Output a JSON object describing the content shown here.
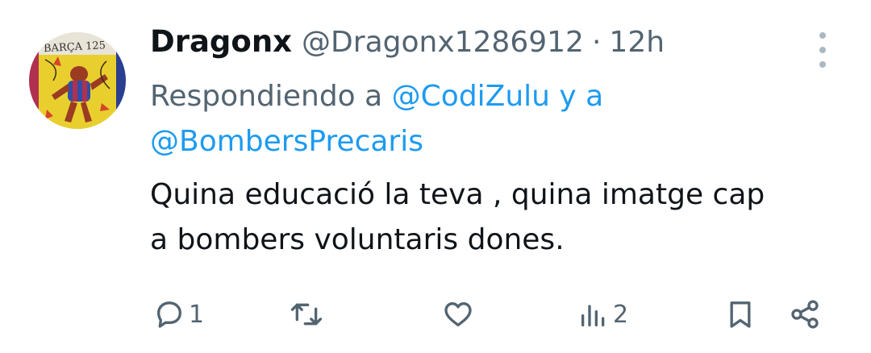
{
  "author": {
    "name": "Dragonx",
    "handle": "@Dragonx1286912",
    "separator": "·",
    "time": "12h",
    "avatar_text": "BARÇA 125"
  },
  "reply": {
    "prefix": "Respondiendo a",
    "mention1": "@CodiZulu",
    "joiner": "y a",
    "mention2": "@BombersPrecaris"
  },
  "text": {
    "line1": "Quina educació la teva , quina imatge cap",
    "line2": "a bombers voluntaris dones."
  },
  "actions": {
    "reply_count": "1",
    "retweet_count": "",
    "like_count": "",
    "views_count": "2",
    "icons": [
      "reply-icon",
      "retweet-icon",
      "like-icon",
      "views-icon",
      "bookmark-icon",
      "share-icon"
    ]
  },
  "colors": {
    "text": "#0f1419",
    "secondary": "#536471",
    "link": "#1d9bf0"
  }
}
